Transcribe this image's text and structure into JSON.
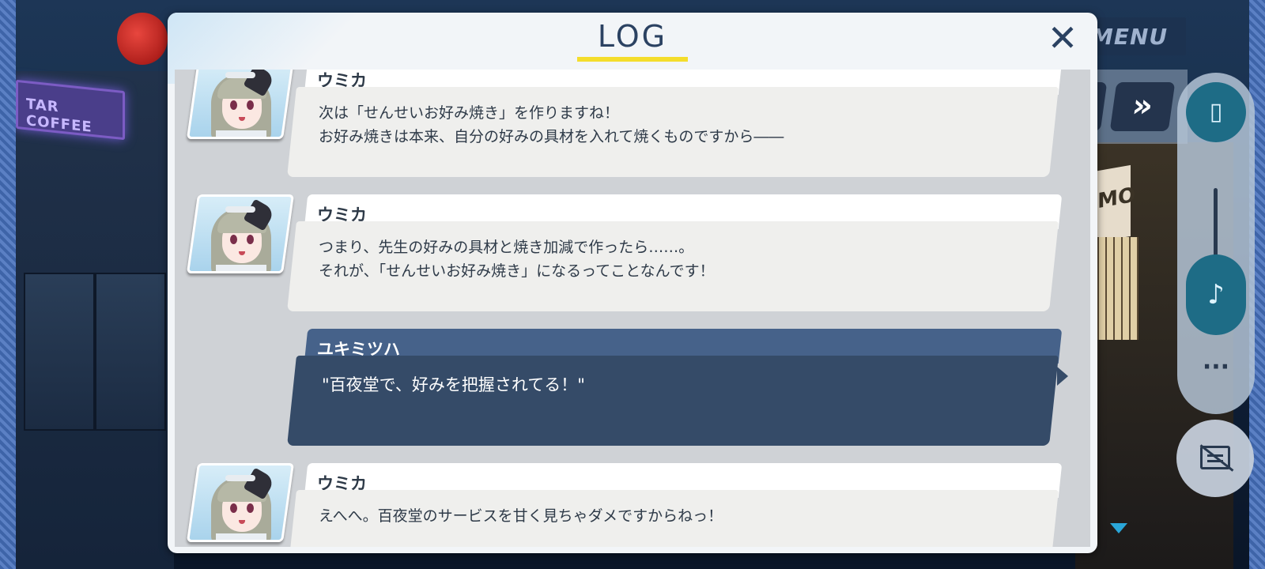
{
  "background": {
    "neon_sign": "TAR COFFEE",
    "shop_sign": "OMO"
  },
  "controls": {
    "menu_label": "MENU",
    "fast_forward_icon": "double-chevron-right-icon",
    "vibration_icon": "vibration-icon",
    "music_icon": "music-note-icon",
    "more_icon": "more-dots-icon",
    "hide_ui_icon": "hide-textbox-icon",
    "scroll_indicator_icon": "triangle-down-icon"
  },
  "log": {
    "title": "LOG",
    "close_icon": "close-x-icon",
    "accent_color": "#f4dd2c",
    "entries": [
      {
        "speaker": "ウミカ",
        "text": "次は「せんせいお好み焼き」を作りますね！\nお好み焼きは本来、自分の好みの具材を入れて焼くものですから――",
        "is_player": false
      },
      {
        "speaker": "ウミカ",
        "text": "つまり、先生の好みの具材と焼き加減で作ったら……。\nそれが、「せんせいお好み焼き」になるってことなんです！",
        "is_player": false
      },
      {
        "speaker": "ユキミツハ",
        "text": "\"百夜堂で、好みを把握されてる！\"",
        "is_player": true
      },
      {
        "speaker": "ウミカ",
        "text": "えへへ。百夜堂のサービスを甘く見ちゃダメですからねっ！",
        "is_player": false
      }
    ]
  }
}
